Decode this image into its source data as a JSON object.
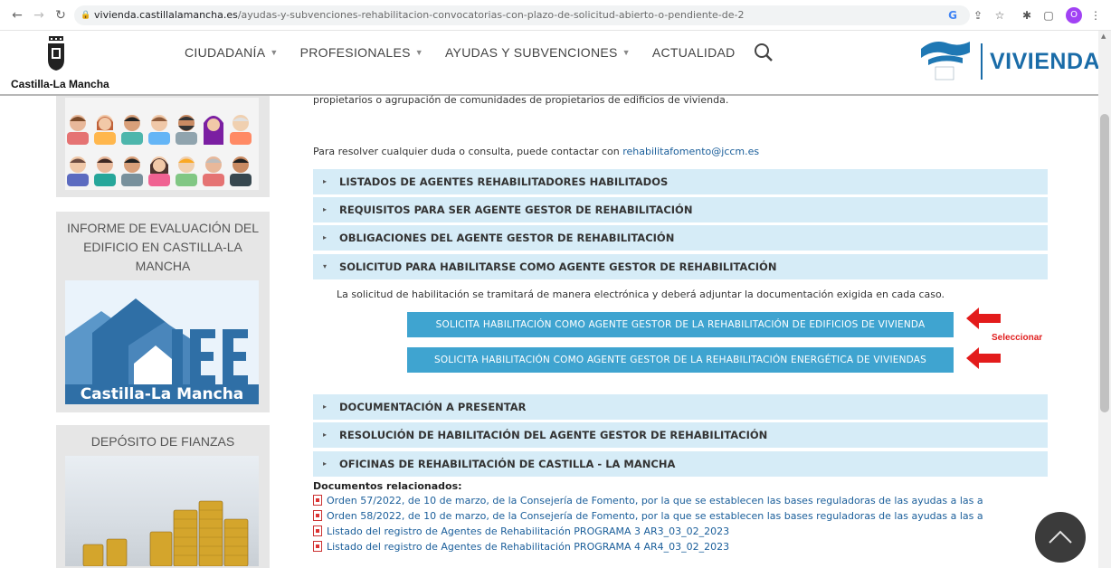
{
  "browser": {
    "url_host": "vivienda.castillalamancha.es",
    "url_path": "/ayudas-y-subvenciones-rehabilitacion-convocatorias-con-plazo-de-solicitud-abierto-o-pendiente-de-2",
    "profile_initial": "O"
  },
  "header": {
    "logo_text": "Castilla-La Mancha",
    "menu": [
      {
        "label": "CIUDADANÍA"
      },
      {
        "label": "PROFESIONALES"
      },
      {
        "label": "AYUDAS Y SUBVENCIONES"
      },
      {
        "label": "ACTUALIDAD"
      }
    ],
    "brand_text": "VIVIENDA"
  },
  "sidebar": {
    "iee_title": "INFORME DE EVALUACIÓN DEL EDIFICIO EN CASTILLA-LA MANCHA",
    "iee_banner": "Castilla-La Mancha",
    "iee_letters": "IEE",
    "fianzas_title": "DEPÓSITO DE FIANZAS"
  },
  "main": {
    "intro_text": "propietarios o agrupación de comunidades de propietarios de edificios de vivienda.",
    "contact_text": "Para resolver cualquier duda o consulta, puede contactar con ",
    "contact_email": "rehabilitafomento@jccm.es",
    "accordion": [
      {
        "label": "LISTADOS DE AGENTES REHABILITADORES HABILITADOS",
        "expanded": false
      },
      {
        "label": "REQUISITOS PARA SER AGENTE GESTOR DE REHABILITACIÓN",
        "expanded": false
      },
      {
        "label": "OBLIGACIONES DEL AGENTE GESTOR DE REHABILITACIÓN",
        "expanded": false
      },
      {
        "label": "SOLICITUD PARA HABILITARSE COMO AGENTE GESTOR DE REHABILITACIÓN",
        "expanded": true
      },
      {
        "label": "DOCUMENTACIÓN A PRESENTAR",
        "expanded": false
      },
      {
        "label": "RESOLUCIÓN DE HABILITACIÓN DEL AGENTE GESTOR DE REHABILITACIÓN",
        "expanded": false
      },
      {
        "label": "OFICINAS DE REHABILITACIÓN DE CASTILLA - LA MANCHA",
        "expanded": false
      }
    ],
    "solicitud_text": "La solicitud de habilitación se tramitará de manera electrónica y deberá adjuntar la documentación exigida en cada caso.",
    "button_1": "SOLICITA HABILITACIÓN COMO AGENTE GESTOR DE LA REHABILITACIÓN DE EDIFICIOS DE VIVIENDA",
    "button_2": "SOLICITA HABILITACIÓN COMO AGENTE GESTOR DE LA REHABILITACIÓN ENERGÉTICA DE VIVIENDAS",
    "annotation": "Seleccionar",
    "docs_title": "Documentos relacionados:",
    "docs": [
      "Orden 57/2022, de 10 de marzo, de la Consejería de Fomento, por la que se establecen las bases reguladoras de las ayudas a las a",
      "Orden 58/2022, de 10 de marzo, de la Consejería de Fomento, por la que se establecen las bases reguladoras de las ayudas a las a",
      "Listado del registro de Agentes de Rehabilitación PROGRAMA 3 AR3_03_02_2023",
      "Listado del registro de Agentes de Rehabilitación PROGRAMA 4 AR4_03_02_2023"
    ]
  },
  "colors": {
    "accordion_bg": "#d6ecf7",
    "button_bg": "#3fa4d0",
    "brand_blue": "#1a6ca8",
    "annotation_red": "#e02020"
  }
}
